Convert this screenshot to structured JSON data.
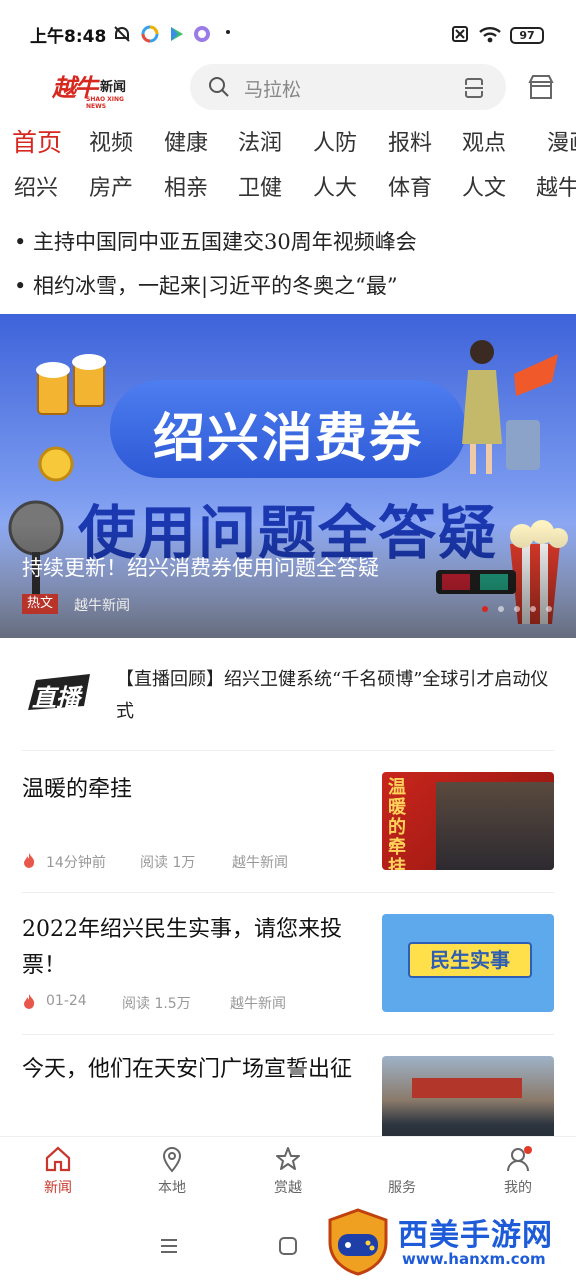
{
  "status_bar": {
    "time": "上午8:48",
    "battery": "97"
  },
  "header": {
    "logo_main": "越牛",
    "logo_sub": "新闻",
    "logo_en": "SHAO XING NEWS",
    "search_placeholder": "马拉松"
  },
  "nav_row1": [
    "首页",
    "视频",
    "健康",
    "法润",
    "人防",
    "报料",
    "观点",
    "漫画"
  ],
  "nav_row2": [
    "绍兴",
    "房产",
    "相亲",
    "卫健",
    "人大",
    "体育",
    "人文",
    "越牛"
  ],
  "headlines": [
    "• 主持中国同中亚五国建交30周年视频峰会",
    "• 相约冰雪，一起来|习近平的冬奥之“最”"
  ],
  "banner": {
    "pill_text": "绍兴消费券",
    "big_text": "使用问题全答疑",
    "caption": "持续更新！绍兴消费券使用问题全答疑",
    "tag": "热文",
    "source": "越牛新闻"
  },
  "live": {
    "icon_text": "直播",
    "text": "【直播回顾】绍兴卫健系统“千名硕博”全球引才启动仪式"
  },
  "news": [
    {
      "title": "温暖的牵挂",
      "time": "14分钟前",
      "reads": "阅读  1万",
      "source": "越牛新闻",
      "image_text": "温暖的牵挂"
    },
    {
      "title": "2022年绍兴民生实事，请您来投票！",
      "time": "01-24",
      "reads": "阅读  1.5万",
      "source": "越牛新闻",
      "image_text": "民生实事"
    },
    {
      "title": "今天，他们在天安门广场宣誓出征",
      "time": "",
      "reads": "",
      "source": "",
      "image_text": ""
    }
  ],
  "tabs": [
    {
      "label": "新闻",
      "icon": "home-icon",
      "active": true
    },
    {
      "label": "本地",
      "icon": "location-pin-icon",
      "active": false
    },
    {
      "label": "赏越",
      "icon": "star-icon",
      "active": false
    },
    {
      "label": "服务",
      "icon": "grid-icon",
      "active": false
    },
    {
      "label": "我的",
      "icon": "user-icon",
      "active": false
    }
  ],
  "watermark": {
    "text": "西美手游网",
    "url": "www.hanxm.com"
  },
  "colors": {
    "accent": "#d6281f",
    "tab_active": "#c8372d",
    "text": "#222222",
    "muted": "#999999"
  }
}
